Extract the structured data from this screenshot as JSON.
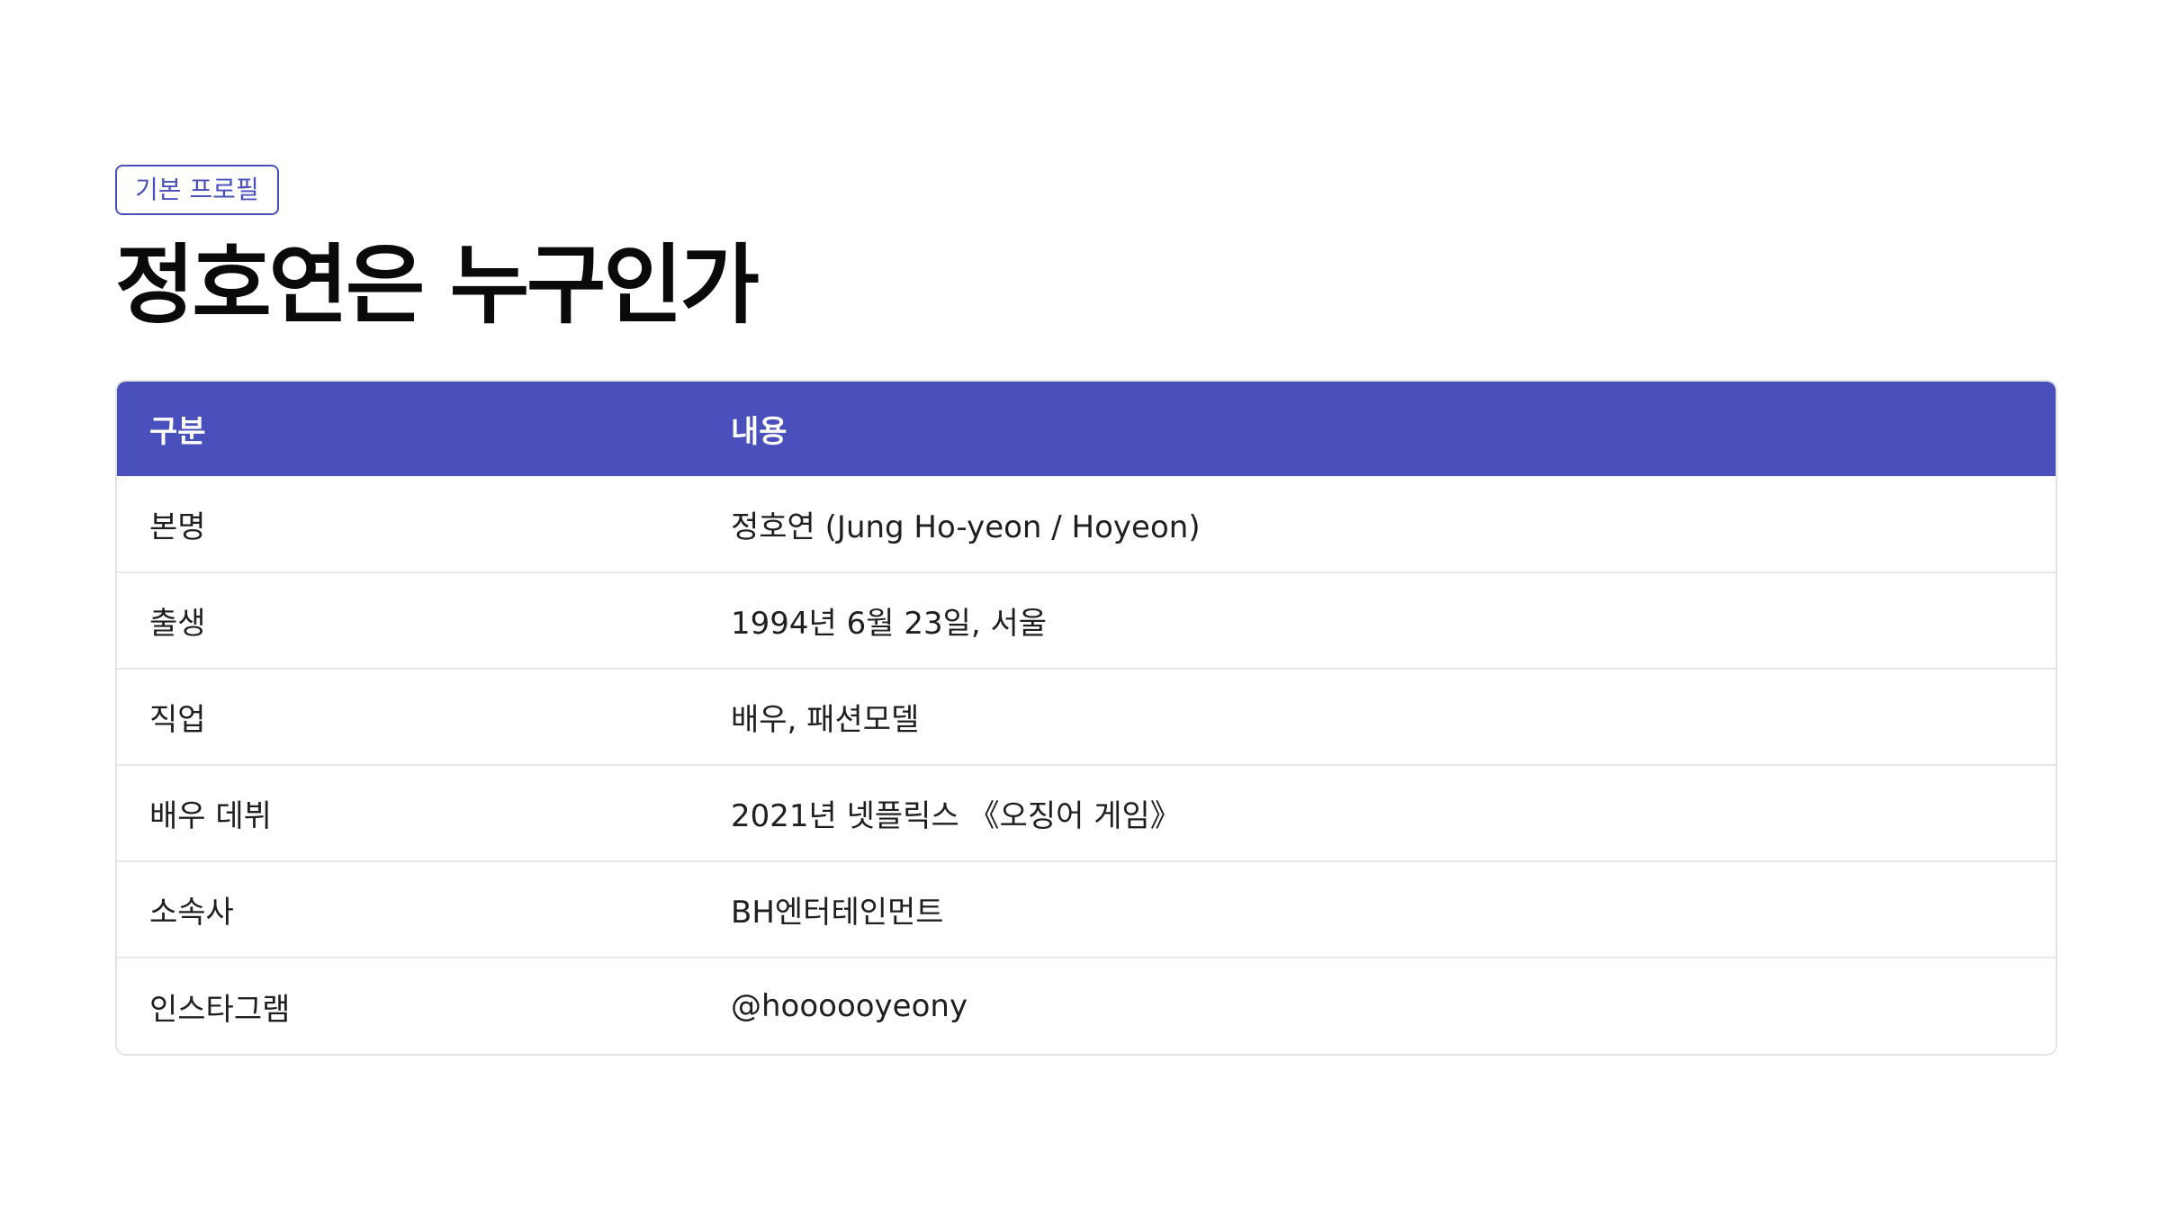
{
  "section_tag": "기본 프로필",
  "title": "정호연은 누구인가",
  "table": {
    "headers": [
      "구분",
      "내용"
    ],
    "rows": [
      [
        "본명",
        "정호연 (Jung Ho-yeon / Hoyeon)"
      ],
      [
        "출생",
        "1994년 6월 23일, 서울"
      ],
      [
        "직업",
        "배우, 패션모델"
      ],
      [
        "배우 데뷔",
        "2021년 넷플릭스 《오징어 게임》"
      ],
      [
        "소속사",
        "BH엔터테인먼트"
      ],
      [
        "인스타그램",
        "@hoooooyeony"
      ]
    ]
  },
  "colors": {
    "accent": "#4a50bb",
    "header_text": "#ffffff",
    "row_border": "#e6e6e6"
  }
}
